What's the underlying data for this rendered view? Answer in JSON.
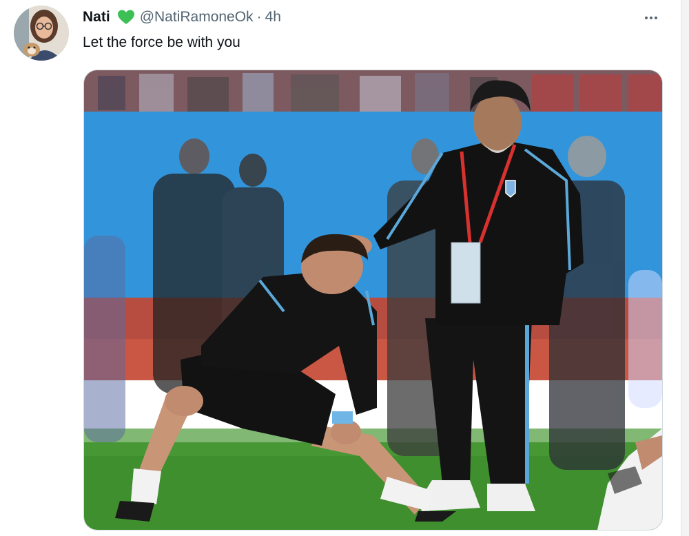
{
  "tweet": {
    "author_name": "Nati",
    "verified_emoji": "green-heart-icon",
    "handle": "@NatiRamoneOk",
    "separator": "·",
    "time": "4h",
    "text": "Let the force be with you",
    "media_description_icon": "photo"
  },
  "colors": {
    "text_primary": "#0f1419",
    "text_secondary": "#536471",
    "heart": "#3cbf55",
    "pitch": "#3f8f2e",
    "wall": "#2f8fd6"
  }
}
